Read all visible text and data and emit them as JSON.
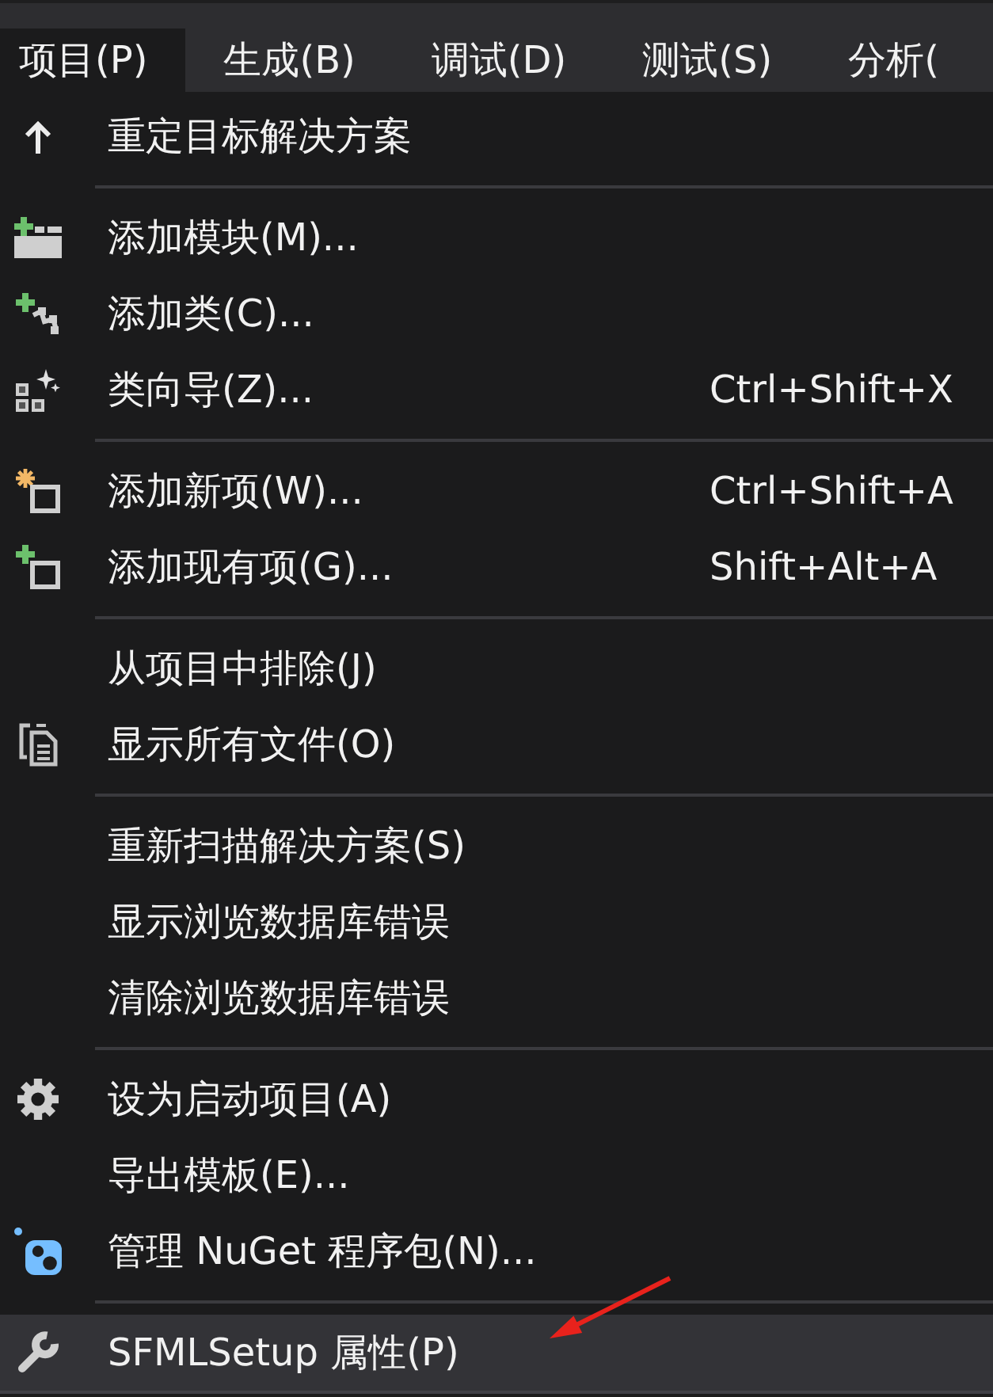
{
  "menu_bar": {
    "items": [
      {
        "label": "项目(P)",
        "selected": true
      },
      {
        "label": "生成(B)",
        "selected": false
      },
      {
        "label": "调试(D)",
        "selected": false
      },
      {
        "label": "测试(S)",
        "selected": false
      },
      {
        "label": "分析(",
        "selected": false
      }
    ]
  },
  "dropdown": {
    "groups": [
      {
        "items": [
          {
            "label": "重定目标解决方案",
            "highlighted": false
          }
        ]
      },
      {
        "items": [
          {
            "label": "添加模块(M)...",
            "highlighted": false
          },
          {
            "label": "添加类(C)...",
            "highlighted": false
          },
          {
            "label": "类向导(Z)...",
            "shortcut": "Ctrl+Shift+X",
            "highlighted": false
          }
        ]
      },
      {
        "items": [
          {
            "label": "添加新项(W)...",
            "shortcut": "Ctrl+Shift+A",
            "highlighted": false
          },
          {
            "label": "添加现有项(G)...",
            "shortcut": "Shift+Alt+A",
            "highlighted": false
          }
        ]
      },
      {
        "items": [
          {
            "label": "从项目中排除(J)",
            "highlighted": false
          },
          {
            "label": "显示所有文件(O)",
            "highlighted": false
          }
        ]
      },
      {
        "items": [
          {
            "label": "重新扫描解决方案(S)",
            "highlighted": false
          },
          {
            "label": "显示浏览数据库错误",
            "highlighted": false
          },
          {
            "label": "清除浏览数据库错误",
            "highlighted": false
          }
        ]
      },
      {
        "items": [
          {
            "label": "设为启动项目(A)",
            "highlighted": false
          },
          {
            "label": "导出模板(E)...",
            "highlighted": false
          },
          {
            "label": "管理 NuGet 程序包(N)...",
            "highlighted": false
          }
        ]
      },
      {
        "items": [
          {
            "label": "SFMLSetup 属性(P)",
            "highlighted": true
          }
        ]
      }
    ]
  }
}
